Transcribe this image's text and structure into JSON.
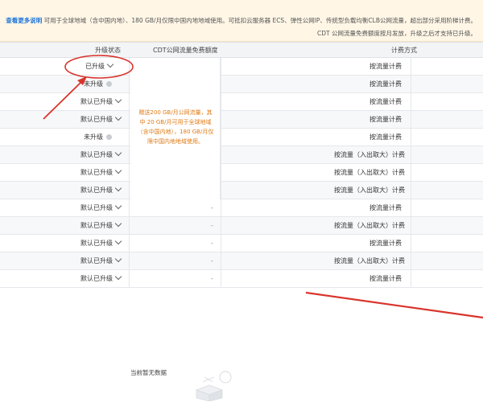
{
  "notice": {
    "line1": "可用于全球地域（含中国内地）、180 GB/月仅限中国内地地域使用。可抵扣云服务器 ECS、弹性公网IP、传统型负载均衡CLB公网流量，超出部分采用阶梯计费。",
    "link": "查看更多说明",
    "line2": "CDT 公网流量免费额度按月发放，升级之后才支持已升级。"
  },
  "table": {
    "headers": {
      "billing_method": "计费方式",
      "cdt_quota": "CDT公网流量免费额度",
      "upgrade_status": "升级状态"
    },
    "cdt_note": "赠送200 GB/月公网流量，其中 20 GB/月可用于全球地域（含中国内地），180 GB/月仅限中国内地地域使用。",
    "rows": [
      {
        "billing": "按流量计费",
        "status": "已升级",
        "status_type": "upgraded"
      },
      {
        "billing": "按流量计费",
        "status": "未升级",
        "status_type": "not"
      },
      {
        "billing": "按流量计费",
        "status": "默认已升级",
        "status_type": "default"
      },
      {
        "billing": "按流量计费",
        "status": "默认已升级",
        "status_type": "default"
      },
      {
        "billing": "按流量计费",
        "status": "未升级",
        "status_type": "not"
      },
      {
        "billing": "按流量（入出取大）计费",
        "status": "默认已升级",
        "status_type": "default"
      },
      {
        "billing": "按流量（入出取大）计费",
        "status": "默认已升级",
        "status_type": "default"
      },
      {
        "billing": "按流量（入出取大）计费",
        "status": "默认已升级",
        "status_type": "default"
      },
      {
        "billing": "按流量计费",
        "status": "默认已升级",
        "status_type": "default",
        "cdt": "-"
      },
      {
        "billing": "按流量（入出取大）计费",
        "status": "默认已升级",
        "status_type": "default",
        "cdt": "-"
      },
      {
        "billing": "按流量计费",
        "status": "默认已升级",
        "status_type": "default",
        "cdt": "-"
      },
      {
        "billing": "按流量（入出取大）计费",
        "status": "默认已升级",
        "status_type": "default",
        "cdt": "-"
      },
      {
        "billing": "按流量计费",
        "status": "默认已升级",
        "status_type": "default",
        "cdt": "-"
      }
    ]
  },
  "empty_state": {
    "text": "当前暂无数据"
  },
  "colors": {
    "accent_orange": "#e07b16",
    "link_blue": "#1a73d9",
    "annotation_red": "#d9342b",
    "notice_bg": "#fff6e6"
  }
}
